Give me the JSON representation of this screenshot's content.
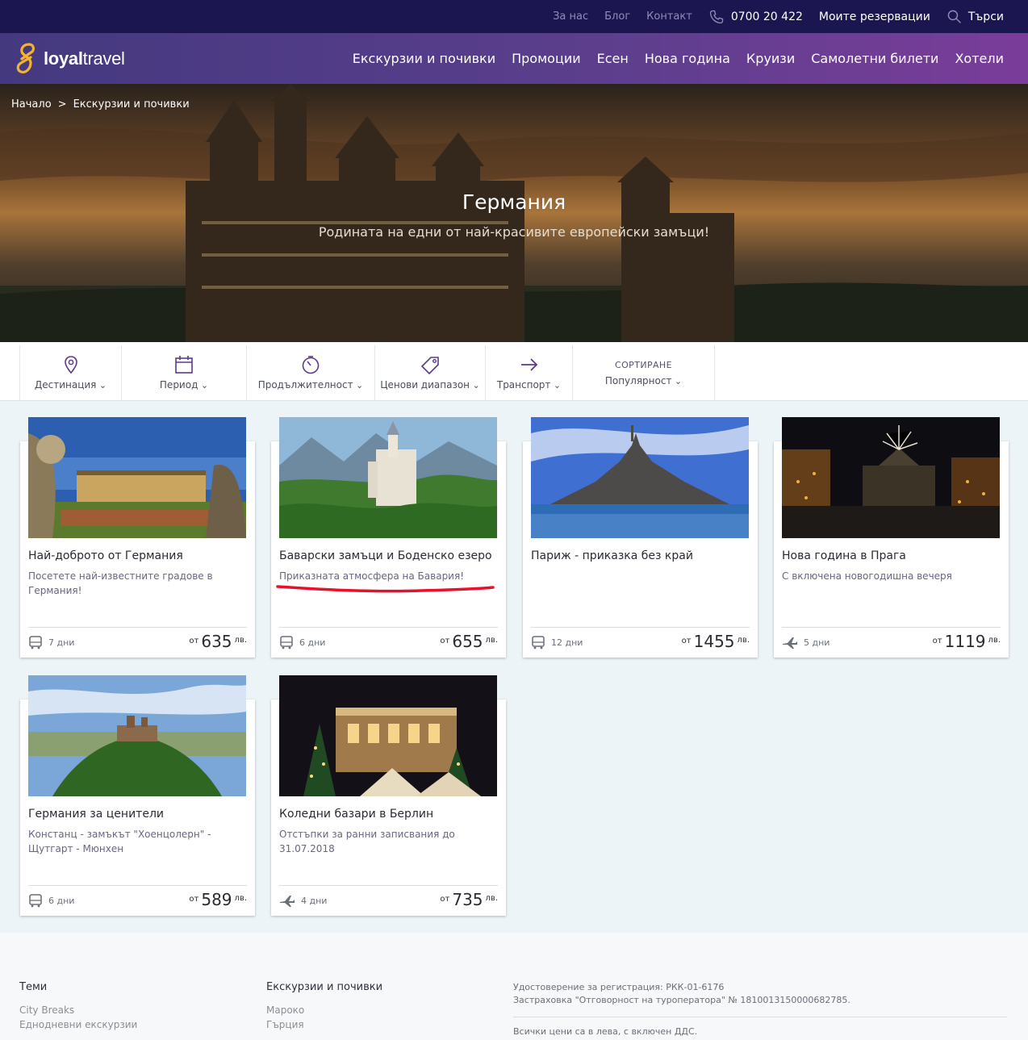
{
  "topbar": {
    "about": "За нас",
    "blog": "Блог",
    "contact": "Контакт",
    "phone": "0700 20 422",
    "bookings": "Моите резервации",
    "search": "Търси"
  },
  "brand": {
    "logo_part1": "loyal",
    "logo_part2": "travel"
  },
  "nav": [
    "Екскурзии и почивки",
    "Промоции",
    "Есен",
    "Нова година",
    "Круизи",
    "Самолетни билети",
    "Хотели"
  ],
  "breadcrumb": {
    "home": "Начало",
    "separator": ">",
    "current": "Екскурзии и почивки"
  },
  "hero": {
    "title": "Германия",
    "subtitle": "Родината на едни от най-красивите европейски замъци!"
  },
  "filters": {
    "destination": "Дестинация",
    "period": "Период",
    "duration": "Продължителност",
    "price_range": "Ценови диапазон",
    "transport": "Транспорт",
    "sort_heading": "СОРТИРАНЕ",
    "sort_value": "Популярност"
  },
  "cards": [
    {
      "title": "Най-доброто от Германия",
      "subtitle": "Посетете най-известните градове в Германия!",
      "days": "7 дни",
      "from": "от",
      "price": "635",
      "currency": "лв.",
      "transport_icon": "bus-icon"
    },
    {
      "title": "Баварски замъци и Боденско езеро",
      "subtitle": "Приказната атмосфера на Бавария!",
      "days": "6 дни",
      "from": "от",
      "price": "655",
      "currency": "лв.",
      "transport_icon": "bus-icon"
    },
    {
      "title": "Париж - приказка без край",
      "subtitle": "",
      "days": "12 дни",
      "from": "от",
      "price": "1455",
      "currency": "лв.",
      "transport_icon": "bus-icon"
    },
    {
      "title": "Нова година в Прага",
      "subtitle": "С включена новогодишна вечеря",
      "days": "5 дни",
      "from": "от",
      "price": "1119",
      "currency": "лв.",
      "transport_icon": "plane-icon"
    },
    {
      "title": "Германия за ценители",
      "subtitle": "Констанц - замъкът \"Хоенцолерн\" - Щутгарт - Мюнхен",
      "days": "6 дни",
      "from": "от",
      "price": "589",
      "currency": "лв.",
      "transport_icon": "bus-icon"
    },
    {
      "title": "Коледни базари в Берлин",
      "subtitle": "Отстъпки за ранни записвания до 31.07.2018",
      "days": "4 дни",
      "from": "от",
      "price": "735",
      "currency": "лв.",
      "transport_icon": "plane-icon"
    }
  ],
  "footer": {
    "themes_heading": "Теми",
    "themes": [
      "City Breaks",
      "Еднодневни екскурзии"
    ],
    "tours_heading": "Екскурзии и почивки",
    "tours": [
      "Мароко",
      "Гърция"
    ],
    "registration": "Удостоверение за регистрация: РКК-01-6176",
    "insurance": "Застраховка \"Отговорност на туроператора\" № 1810013150000682785.",
    "prices_note": "Всички цени са в лева, с включен ДДС."
  },
  "colors": {
    "topbar": "#1c1650",
    "nav_start": "#44397f",
    "nav_end": "#7a3d99",
    "accent": "#5b3a8e",
    "logo_accent": "#f2b233",
    "highlight": "#e8102a"
  }
}
